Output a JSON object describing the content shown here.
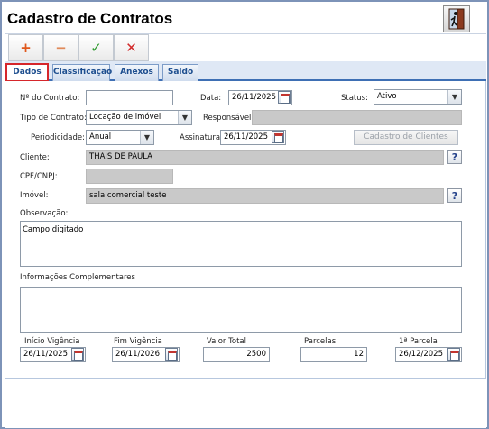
{
  "window": {
    "title": "Cadastro de Contratos"
  },
  "toolbar": {
    "add": "+",
    "remove": "−",
    "confirm": "✓",
    "cancel": "✕"
  },
  "tabs": [
    {
      "label": "Dados",
      "active": true
    },
    {
      "label": "Classificação"
    },
    {
      "label": "Anexos"
    },
    {
      "label": "Saldo"
    }
  ],
  "form": {
    "numero_label": "Nº do Contrato:",
    "numero_value": "",
    "data_label": "Data:",
    "data_value": "26/11/2025",
    "status_label": "Status:",
    "status_value": "Ativo",
    "tipo_label": "Tipo de Contrato:",
    "tipo_value": "Locação de imóvel",
    "responsavel_label": "Responsável:",
    "responsavel_value": "",
    "periodicidade_label": "Periodicidade:",
    "periodicidade_value": "Anual",
    "assinatura_label": "Assinatura:",
    "assinatura_value": "26/11/2025",
    "cadastro_clientes_button": "Cadastro de Clientes",
    "cliente_label": "Cliente:",
    "cliente_value": "THAIS DE PAULA",
    "cpf_label": "CPF/CNPJ:",
    "cpf_value": "",
    "imovel_label": "Imóvel:",
    "imovel_value": "sala comercial teste",
    "observacao_label": "Observação:",
    "observacao_value": "Campo digitado",
    "info_label": "Informações Complementares",
    "info_value": "",
    "inicio_label": "Início Vigência",
    "inicio_value": "26/11/2025",
    "fim_label": "Fim Vigência",
    "fim_value": "26/11/2026",
    "valor_label": "Valor Total",
    "valor_value": "2500",
    "parcelas_label": "Parcelas",
    "parcelas_value": "12",
    "primeira_label": "1ª Parcela",
    "primeira_value": "26/12/2025",
    "help_glyph": "?"
  },
  "colors": {
    "accent": "#3e6fb4",
    "active_tab_border": "#d6262b",
    "readonly": "#c9c9c9"
  }
}
